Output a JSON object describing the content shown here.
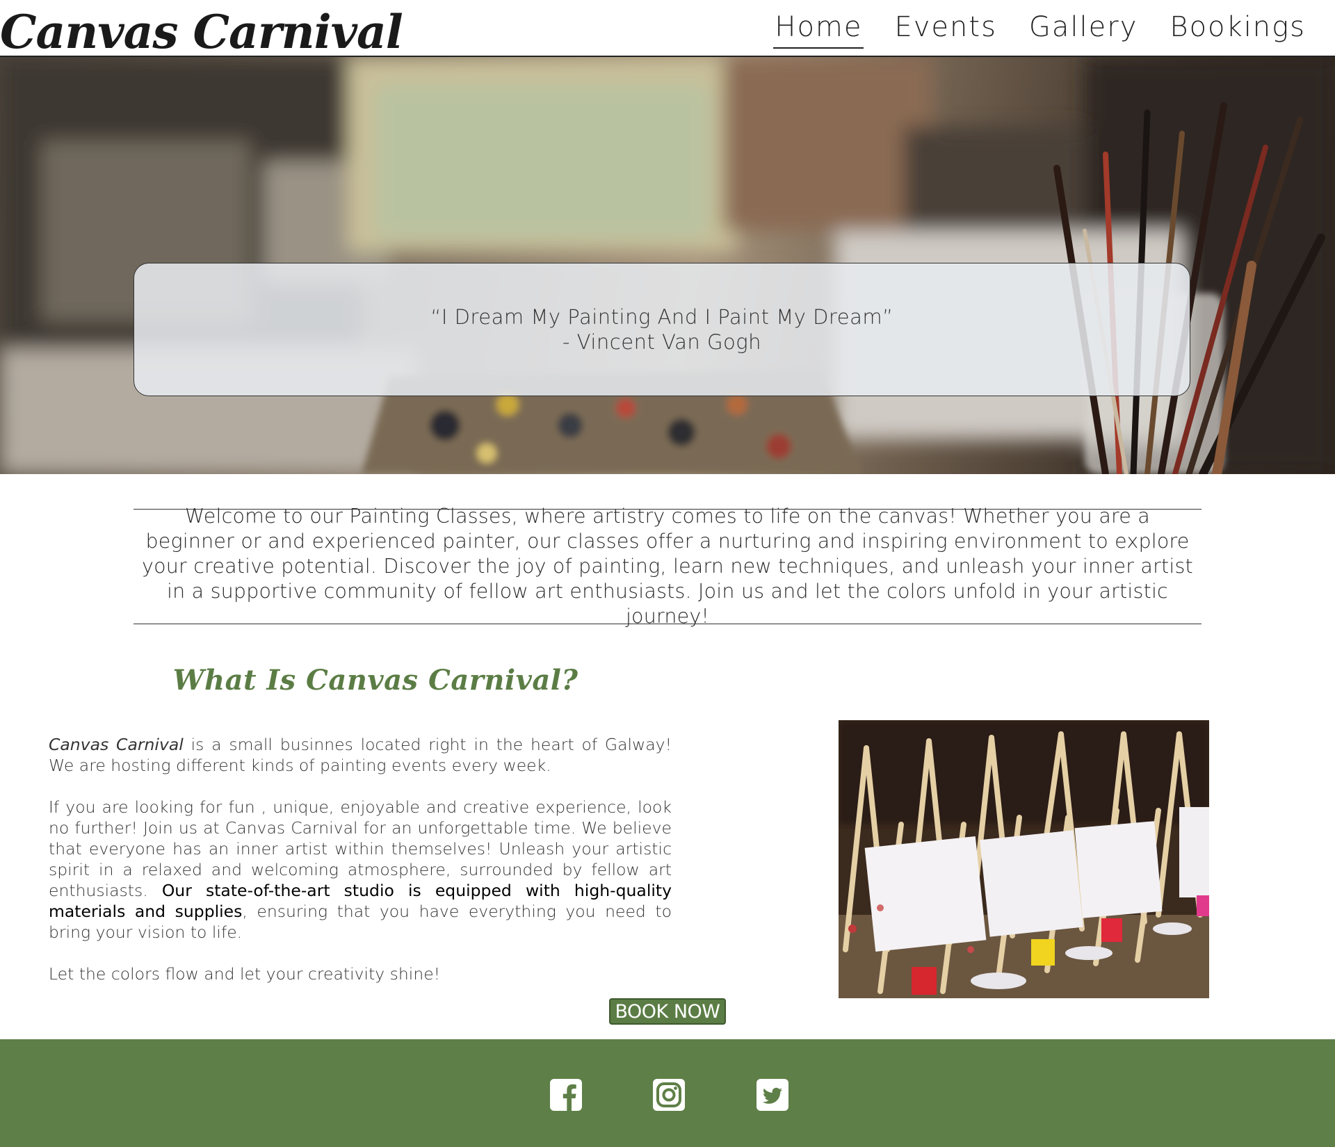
{
  "header": {
    "logo": "Canvas Carnival",
    "nav": [
      {
        "label": "Home",
        "active": true
      },
      {
        "label": "Events",
        "active": false
      },
      {
        "label": "Gallery",
        "active": false
      },
      {
        "label": "Bookings",
        "active": false
      }
    ]
  },
  "hero": {
    "quote": "“I Dream My Painting And I Paint My Dream”",
    "author": "- Vincent Van Gogh"
  },
  "welcome": {
    "text": "Welcome to our Painting Classes, where artistry comes to life on the canvas! Whether you are a beginner or and experienced painter, our classes offer a nurturing and inspiring environment to explore your creative potential. Discover the joy of painting, learn new techniques, and unleash your inner artist in a supportive community of fellow art enthusiasts. Join us and let the colors unfold in your artistic journey!"
  },
  "about": {
    "title": "What Is Canvas Carnival?",
    "p1_brand": "Canvas Carnival",
    "p1_rest": " is a small businnes located right in the heart of Galway! We are hosting different kinds of painting events every week.",
    "p2_start": "If you are looking for fun , unique, enjoyable and creative experience, look no further! Join us at Canvas Carnival for an unforgettable time. We believe that everyone has an inner artist within themselves! Unleash your artistic spirit in a relaxed and welcoming atmosphere, surrounded by fellow art enthusiasts. ",
    "p2_bold": "Our state-of-the-art studio is equipped with high-quality materials and supplies",
    "p2_end": ", ensuring that you have everything you need to bring your vision to life.",
    "p3": "Let the colors flow and let your creativity shine!",
    "book_button": "BOOK NOW"
  },
  "footer": {
    "social": [
      {
        "icon": "facebook-icon"
      },
      {
        "icon": "instagram-icon"
      },
      {
        "icon": "twitter-icon"
      }
    ]
  },
  "colors": {
    "accent_green": "#5b7d45",
    "footer_green": "#5e7f47",
    "text_dark": "#222222"
  }
}
